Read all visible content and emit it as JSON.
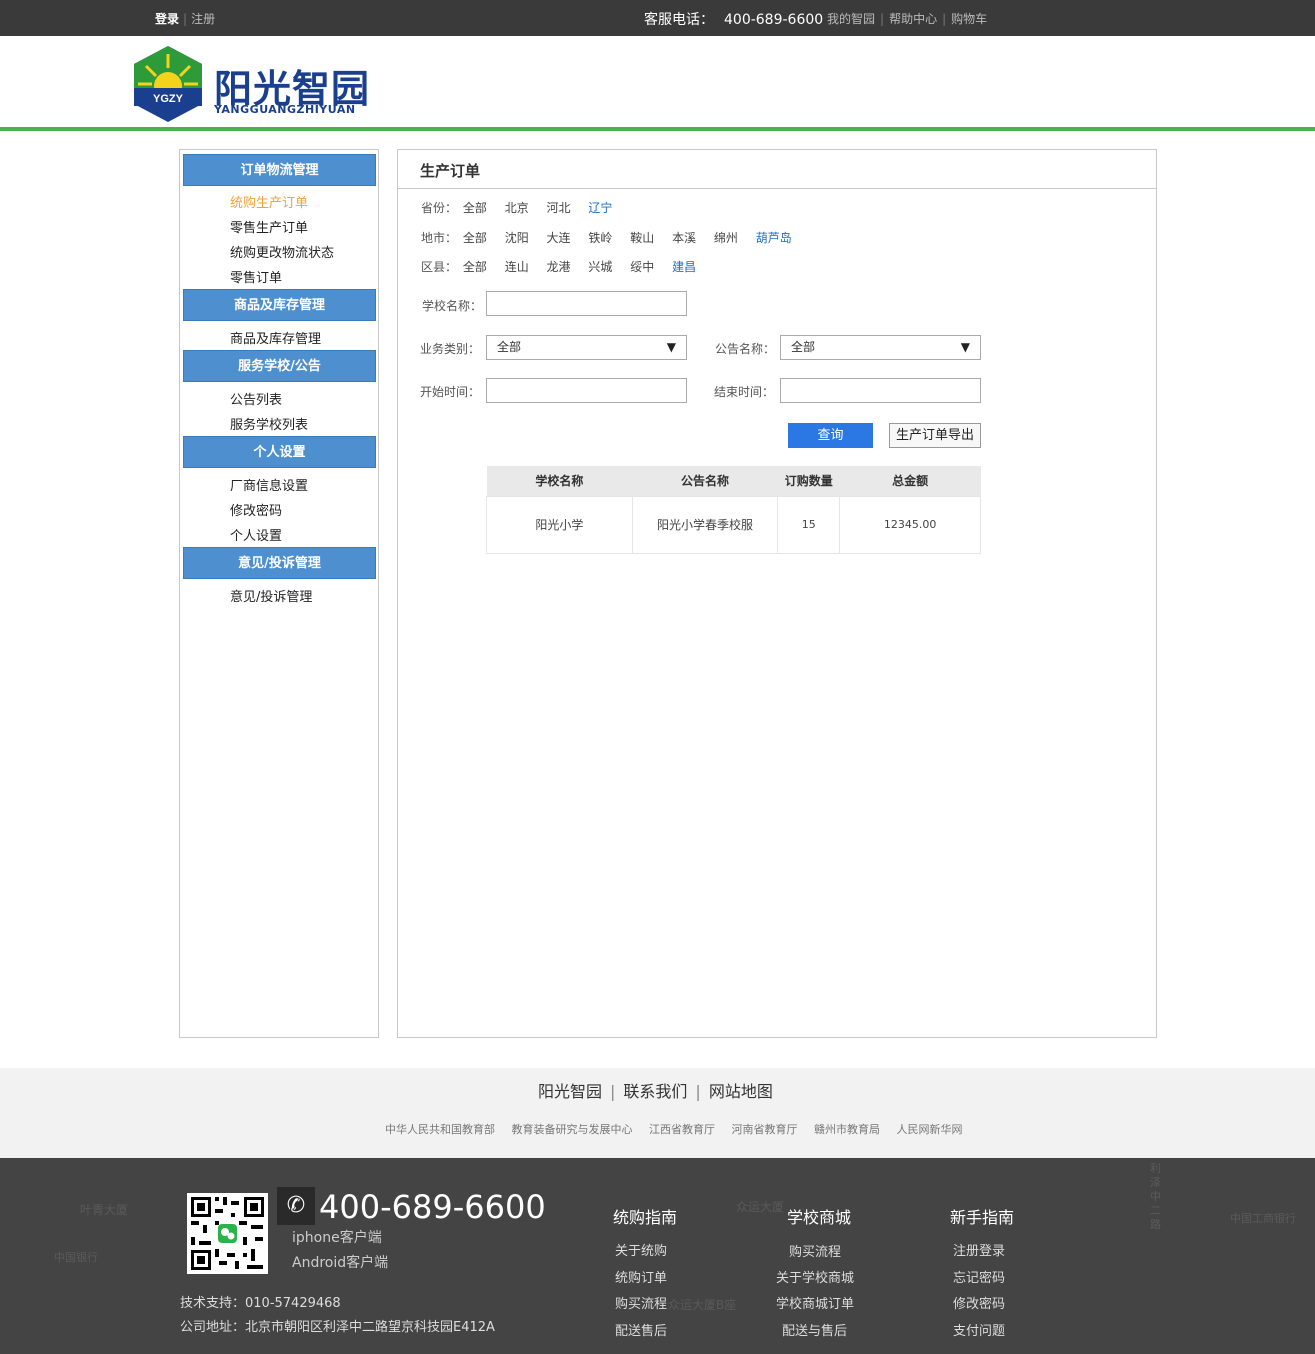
{
  "topbar": {
    "login": "登录",
    "register": "注册",
    "phone_label": "客服电话：",
    "phone": "400-689-6600",
    "links": [
      "我的智园",
      "帮助中心",
      "购物车"
    ]
  },
  "header": {
    "logo_badge": "YGZY",
    "logo_title": "阳光智园",
    "logo_sub": "YANGGUANGZHIYUAN"
  },
  "sidebar": {
    "groups": [
      {
        "title": "订单物流管理",
        "items": [
          "统购生产订单",
          "零售生产订单",
          "统购更改物流状态",
          "零售订单"
        ]
      },
      {
        "title": "商品及库存管理",
        "items": [
          "商品及库存管理"
        ]
      },
      {
        "title": "服务学校/公告",
        "items": [
          "公告列表",
          "服务学校列表"
        ]
      },
      {
        "title": "个人设置",
        "items": [
          "厂商信息设置",
          "修改密码",
          "个人设置"
        ]
      },
      {
        "title": "意见/投诉管理",
        "items": [
          "意见/投诉管理"
        ]
      }
    ]
  },
  "main": {
    "title": "生产订单",
    "filters": {
      "province": {
        "label": "省份：",
        "options": [
          "全部",
          "北京",
          "河北",
          "辽宁"
        ],
        "selected": "辽宁"
      },
      "city": {
        "label": "地市：",
        "options": [
          "全部",
          "沈阳",
          "大连",
          "铁岭",
          "鞍山",
          "本溪",
          "绵州",
          "葫芦岛"
        ],
        "selected": "葫芦岛"
      },
      "county": {
        "label": "区县：",
        "options": [
          "全部",
          "连山",
          "龙港",
          "兴城",
          "绥中",
          "建昌"
        ],
        "selected": "建昌"
      }
    },
    "form": {
      "school_label": "学校名称：",
      "biz_label": "业务类别：",
      "biz_value": "全部",
      "notice_label": "公告名称：",
      "notice_value": "全部",
      "start_label": "开始时间：",
      "end_label": "结束时间：",
      "query_btn": "查询",
      "export_btn": "生产订单导出"
    },
    "table": {
      "headers": [
        "学校名称",
        "公告名称",
        "订购数量",
        "总金额"
      ],
      "rows": [
        [
          "阳光小学",
          "阳光小学春季校服",
          "15",
          "12345.00"
        ]
      ]
    }
  },
  "footer": {
    "links": [
      "阳光智园",
      "联系我们",
      "网站地图"
    ],
    "sub_links": [
      "中华人民共和国教育部",
      "教育装备研究与发展中心",
      "江西省教育厅",
      "河南省教育厅",
      "赣州市教育局",
      "人民网新华网"
    ],
    "phone": "400-689-6600",
    "clients": [
      "iphone客户端",
      "Android客户端"
    ],
    "tech_support": "技术支持：010-57429468",
    "address": "公司地址：北京市朝阳区利泽中二路望京科技园E412A",
    "columns": [
      {
        "title": "统购指南",
        "items": [
          "关于统购",
          "统购订单",
          "购买流程",
          "配送售后"
        ]
      },
      {
        "title": "学校商城",
        "items": [
          "购买流程",
          "关于学校商城",
          "学校商城订单",
          "配送与售后"
        ]
      },
      {
        "title": "新手指南",
        "items": [
          "注册登录",
          "忘记密码",
          "修改密码",
          "支付问题"
        ]
      }
    ],
    "map_labels": [
      "叶青大厦",
      "中国银行",
      "众运大厦",
      "中国工商银行",
      "众运大厦B座",
      "利泽中二路"
    ]
  }
}
